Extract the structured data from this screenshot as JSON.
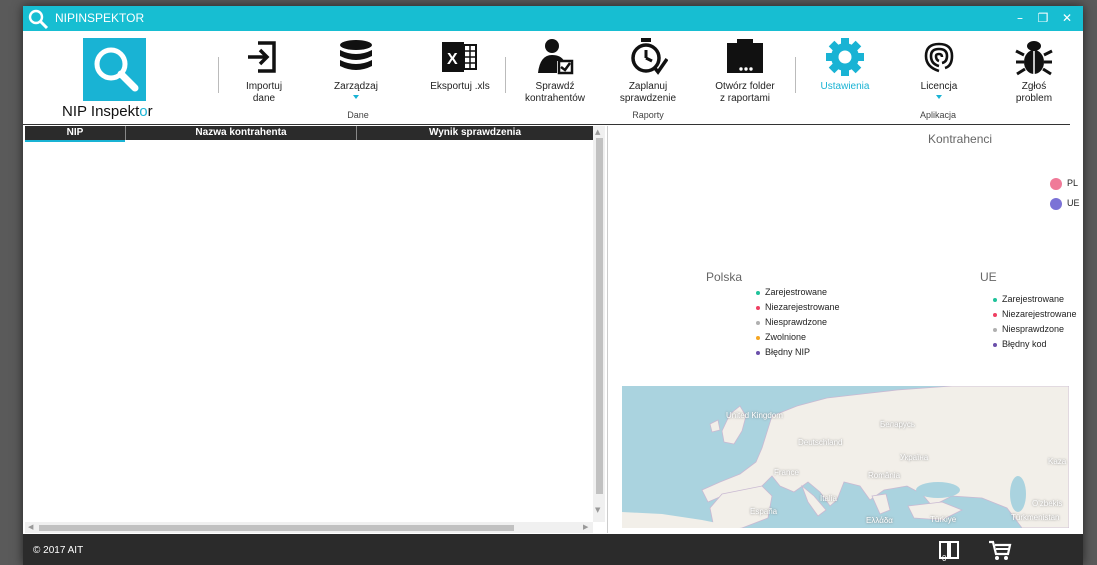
{
  "window": {
    "title": "NIPINSPEKTOR"
  },
  "logo": {
    "text_main": "NIP Inspekt",
    "text_accent": "o",
    "text_end": "r"
  },
  "ribbon": {
    "buttons": [
      {
        "label": "Importuj\ndane",
        "icon": "import-icon"
      },
      {
        "label": "Zarządzaj",
        "icon": "database-icon"
      },
      {
        "label": "Eksportuj .xls",
        "icon": "excel-icon"
      },
      {
        "label": "Sprawdź\nkontrahentów",
        "icon": "check-user-icon"
      },
      {
        "label": "Zaplanuj\nsprawdzenie",
        "icon": "stopwatch-icon"
      },
      {
        "label": "Otwórz folder\nz raportami",
        "icon": "folder-icon"
      },
      {
        "label": "Ustawienia",
        "icon": "gear-icon"
      },
      {
        "label": "Licencja",
        "icon": "fingerprint-icon"
      },
      {
        "label": "Zgłoś\nproblem",
        "icon": "bug-icon"
      }
    ],
    "groups": {
      "dane": "Dane",
      "raporty": "Raporty",
      "aplikacja": "Aplikacja"
    }
  },
  "table": {
    "columns": [
      "NIP",
      "Nazwa kontrahenta",
      "Wynik sprawdzenia"
    ],
    "rows": []
  },
  "charts": {
    "kontrahenci": {
      "title": "Kontrahenci",
      "legend": [
        {
          "label": "PL",
          "color": "#f07a98"
        },
        {
          "label": "UE",
          "color": "#7b72d6"
        }
      ]
    },
    "polska": {
      "title": "Polska",
      "legend": [
        {
          "label": "Zarejestrowane",
          "color": "#1fc29a"
        },
        {
          "label": "Niezarejestrowane",
          "color": "#ef3f62"
        },
        {
          "label": "Niesprawdzone",
          "color": "#b0b0b0"
        },
        {
          "label": "Zwolnione",
          "color": "#f5a623"
        },
        {
          "label": "Błędny NIP",
          "color": "#6b4faa"
        }
      ]
    },
    "ue": {
      "title": "UE",
      "legend": [
        {
          "label": "Zarejestrowane",
          "color": "#1fc29a"
        },
        {
          "label": "Niezarejestrowane",
          "color": "#ef3f62"
        },
        {
          "label": "Niesprawdzone",
          "color": "#b0b0b0"
        },
        {
          "label": "Błędny kod",
          "color": "#6b4faa"
        }
      ]
    }
  },
  "map": {
    "labels": [
      "United Kingdom",
      "Беларусь",
      "Deutschland",
      "Україна",
      "France",
      "România",
      "Kaza",
      "Italia",
      "O'zbekis",
      "España",
      "Ελλάδα",
      "Türkiye",
      "Türkmenistan"
    ]
  },
  "status": {
    "copyright": "© 2017 AIT"
  },
  "colors": {
    "accent": "#17bed2",
    "dark": "#2b2b2b"
  }
}
